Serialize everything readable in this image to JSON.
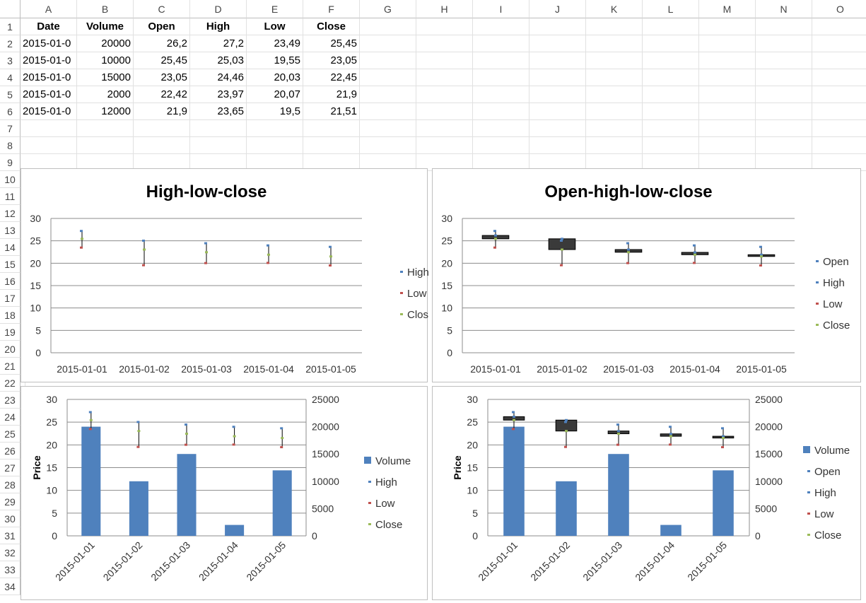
{
  "sheet": {
    "columns": [
      "A",
      "B",
      "C",
      "D",
      "E",
      "F",
      "G",
      "H",
      "I",
      "J",
      "K",
      "L",
      "M",
      "N",
      "O"
    ],
    "rows": [
      "1",
      "2",
      "3",
      "4",
      "5",
      "6",
      "7",
      "8",
      "9",
      "10",
      "11",
      "12",
      "13",
      "14",
      "15",
      "16",
      "17",
      "18",
      "19",
      "20",
      "21",
      "22",
      "23",
      "24",
      "25",
      "26",
      "27",
      "28",
      "29",
      "30",
      "31",
      "32",
      "33",
      "34"
    ],
    "headers": [
      "Date",
      "Volume",
      "Open",
      "High",
      "Low",
      "Close"
    ],
    "data": [
      [
        "2015-01-0",
        "20000",
        "26,2",
        "27,2",
        "23,49",
        "25,45"
      ],
      [
        "2015-01-0",
        "10000",
        "25,45",
        "25,03",
        "19,55",
        "23,05"
      ],
      [
        "2015-01-0",
        "15000",
        "23,05",
        "24,46",
        "20,03",
        "22,45"
      ],
      [
        "2015-01-0",
        "2000",
        "22,42",
        "23,97",
        "20,07",
        "21,9"
      ],
      [
        "2015-01-0",
        "12000",
        "21,9",
        "23,65",
        "19,5",
        "21,51"
      ]
    ]
  },
  "colors": {
    "volume": "#4f81bd",
    "high": "#4f81bd",
    "low": "#c0504d",
    "close": "#9bbb59",
    "candle_down": "#3a3a3a",
    "candle_up": "#ffffff",
    "gridline": "#8c8c8c"
  },
  "chart_data": [
    {
      "type": "stock-hlc",
      "title": "High-low-close",
      "categories": [
        "2015-01-01",
        "2015-01-02",
        "2015-01-03",
        "2015-01-04",
        "2015-01-05"
      ],
      "series": [
        {
          "name": "High",
          "values": [
            27.2,
            25.03,
            24.46,
            23.97,
            23.65
          ]
        },
        {
          "name": "Low",
          "values": [
            23.49,
            19.55,
            20.03,
            20.07,
            19.5
          ]
        },
        {
          "name": "Close",
          "values": [
            25.45,
            23.05,
            22.45,
            21.9,
            21.51
          ]
        }
      ],
      "yticks": [
        "0",
        "5",
        "10",
        "15",
        "20",
        "25",
        "30"
      ],
      "ylim": [
        0,
        30
      ],
      "legend": "right",
      "grid": true
    },
    {
      "type": "stock-ohlc",
      "title": "Open-high-low-close",
      "categories": [
        "2015-01-01",
        "2015-01-02",
        "2015-01-03",
        "2015-01-04",
        "2015-01-05"
      ],
      "series": [
        {
          "name": "Open",
          "values": [
            26.2,
            25.45,
            23.05,
            22.42,
            21.9
          ]
        },
        {
          "name": "High",
          "values": [
            27.2,
            25.03,
            24.46,
            23.97,
            23.65
          ]
        },
        {
          "name": "Low",
          "values": [
            23.49,
            19.55,
            20.03,
            20.07,
            19.5
          ]
        },
        {
          "name": "Close",
          "values": [
            25.45,
            23.05,
            22.45,
            21.9,
            21.51
          ]
        }
      ],
      "yticks": [
        "0",
        "5",
        "10",
        "15",
        "20",
        "25",
        "30"
      ],
      "ylim": [
        0,
        30
      ],
      "legend": "right",
      "grid": true
    },
    {
      "type": "stock-vhlc",
      "title": "",
      "ylabel": "Price",
      "categories": [
        "2015-01-01",
        "2015-01-02",
        "2015-01-03",
        "2015-01-04",
        "2015-01-05"
      ],
      "series": [
        {
          "name": "Volume",
          "values": [
            20000,
            10000,
            15000,
            2000,
            12000
          ]
        },
        {
          "name": "High",
          "values": [
            27.2,
            25.03,
            24.46,
            23.97,
            23.65
          ]
        },
        {
          "name": "Low",
          "values": [
            23.49,
            19.55,
            20.03,
            20.07,
            19.5
          ]
        },
        {
          "name": "Close",
          "values": [
            25.45,
            23.05,
            22.45,
            21.9,
            21.51
          ]
        }
      ],
      "yticks": [
        "0",
        "5",
        "10",
        "15",
        "20",
        "25",
        "30"
      ],
      "ylim": [
        0,
        30
      ],
      "y2ticks": [
        "0",
        "5000",
        "10000",
        "15000",
        "20000",
        "25000"
      ],
      "y2lim": [
        0,
        25000
      ],
      "legend": "right",
      "grid": true
    },
    {
      "type": "stock-vohlc",
      "title": "",
      "ylabel": "Price",
      "categories": [
        "2015-01-01",
        "2015-01-02",
        "2015-01-03",
        "2015-01-04",
        "2015-01-05"
      ],
      "series": [
        {
          "name": "Volume",
          "values": [
            20000,
            10000,
            15000,
            2000,
            12000
          ]
        },
        {
          "name": "Open",
          "values": [
            26.2,
            25.45,
            23.05,
            22.42,
            21.9
          ]
        },
        {
          "name": "High",
          "values": [
            27.2,
            25.03,
            24.46,
            23.97,
            23.65
          ]
        },
        {
          "name": "Low",
          "values": [
            23.49,
            19.55,
            20.03,
            20.07,
            19.5
          ]
        },
        {
          "name": "Close",
          "values": [
            25.45,
            23.05,
            22.45,
            21.9,
            21.51
          ]
        }
      ],
      "yticks": [
        "0",
        "5",
        "10",
        "15",
        "20",
        "25",
        "30"
      ],
      "ylim": [
        0,
        30
      ],
      "y2ticks": [
        "0",
        "5000",
        "10000",
        "15000",
        "20000",
        "25000"
      ],
      "y2lim": [
        0,
        25000
      ],
      "legend": "right",
      "grid": true
    }
  ]
}
